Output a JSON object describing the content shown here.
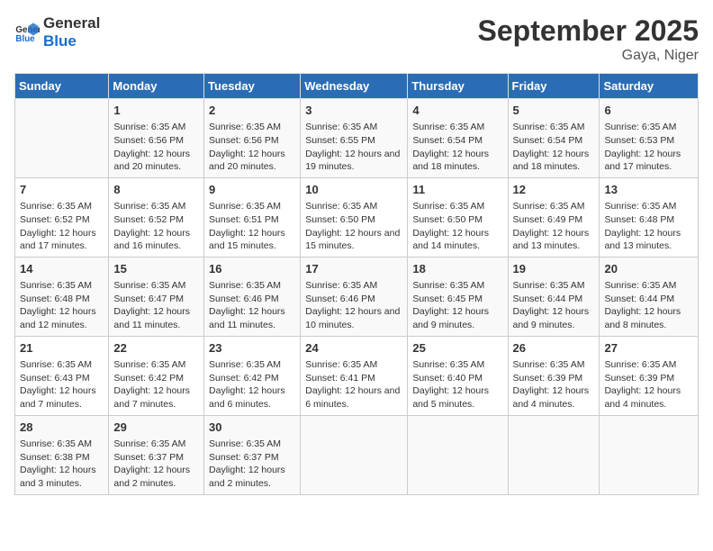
{
  "logo": {
    "line1": "General",
    "line2": "Blue"
  },
  "title": "September 2025",
  "location": "Gaya, Niger",
  "days_of_week": [
    "Sunday",
    "Monday",
    "Tuesday",
    "Wednesday",
    "Thursday",
    "Friday",
    "Saturday"
  ],
  "weeks": [
    [
      {
        "day": "",
        "info": ""
      },
      {
        "day": "1",
        "info": "Sunrise: 6:35 AM\nSunset: 6:56 PM\nDaylight: 12 hours and 20 minutes."
      },
      {
        "day": "2",
        "info": "Sunrise: 6:35 AM\nSunset: 6:56 PM\nDaylight: 12 hours and 20 minutes."
      },
      {
        "day": "3",
        "info": "Sunrise: 6:35 AM\nSunset: 6:55 PM\nDaylight: 12 hours and 19 minutes."
      },
      {
        "day": "4",
        "info": "Sunrise: 6:35 AM\nSunset: 6:54 PM\nDaylight: 12 hours and 18 minutes."
      },
      {
        "day": "5",
        "info": "Sunrise: 6:35 AM\nSunset: 6:54 PM\nDaylight: 12 hours and 18 minutes."
      },
      {
        "day": "6",
        "info": "Sunrise: 6:35 AM\nSunset: 6:53 PM\nDaylight: 12 hours and 17 minutes."
      }
    ],
    [
      {
        "day": "7",
        "info": "Sunrise: 6:35 AM\nSunset: 6:52 PM\nDaylight: 12 hours and 17 minutes."
      },
      {
        "day": "8",
        "info": "Sunrise: 6:35 AM\nSunset: 6:52 PM\nDaylight: 12 hours and 16 minutes."
      },
      {
        "day": "9",
        "info": "Sunrise: 6:35 AM\nSunset: 6:51 PM\nDaylight: 12 hours and 15 minutes."
      },
      {
        "day": "10",
        "info": "Sunrise: 6:35 AM\nSunset: 6:50 PM\nDaylight: 12 hours and 15 minutes."
      },
      {
        "day": "11",
        "info": "Sunrise: 6:35 AM\nSunset: 6:50 PM\nDaylight: 12 hours and 14 minutes."
      },
      {
        "day": "12",
        "info": "Sunrise: 6:35 AM\nSunset: 6:49 PM\nDaylight: 12 hours and 13 minutes."
      },
      {
        "day": "13",
        "info": "Sunrise: 6:35 AM\nSunset: 6:48 PM\nDaylight: 12 hours and 13 minutes."
      }
    ],
    [
      {
        "day": "14",
        "info": "Sunrise: 6:35 AM\nSunset: 6:48 PM\nDaylight: 12 hours and 12 minutes."
      },
      {
        "day": "15",
        "info": "Sunrise: 6:35 AM\nSunset: 6:47 PM\nDaylight: 12 hours and 11 minutes."
      },
      {
        "day": "16",
        "info": "Sunrise: 6:35 AM\nSunset: 6:46 PM\nDaylight: 12 hours and 11 minutes."
      },
      {
        "day": "17",
        "info": "Sunrise: 6:35 AM\nSunset: 6:46 PM\nDaylight: 12 hours and 10 minutes."
      },
      {
        "day": "18",
        "info": "Sunrise: 6:35 AM\nSunset: 6:45 PM\nDaylight: 12 hours and 9 minutes."
      },
      {
        "day": "19",
        "info": "Sunrise: 6:35 AM\nSunset: 6:44 PM\nDaylight: 12 hours and 9 minutes."
      },
      {
        "day": "20",
        "info": "Sunrise: 6:35 AM\nSunset: 6:44 PM\nDaylight: 12 hours and 8 minutes."
      }
    ],
    [
      {
        "day": "21",
        "info": "Sunrise: 6:35 AM\nSunset: 6:43 PM\nDaylight: 12 hours and 7 minutes."
      },
      {
        "day": "22",
        "info": "Sunrise: 6:35 AM\nSunset: 6:42 PM\nDaylight: 12 hours and 7 minutes."
      },
      {
        "day": "23",
        "info": "Sunrise: 6:35 AM\nSunset: 6:42 PM\nDaylight: 12 hours and 6 minutes."
      },
      {
        "day": "24",
        "info": "Sunrise: 6:35 AM\nSunset: 6:41 PM\nDaylight: 12 hours and 6 minutes."
      },
      {
        "day": "25",
        "info": "Sunrise: 6:35 AM\nSunset: 6:40 PM\nDaylight: 12 hours and 5 minutes."
      },
      {
        "day": "26",
        "info": "Sunrise: 6:35 AM\nSunset: 6:39 PM\nDaylight: 12 hours and 4 minutes."
      },
      {
        "day": "27",
        "info": "Sunrise: 6:35 AM\nSunset: 6:39 PM\nDaylight: 12 hours and 4 minutes."
      }
    ],
    [
      {
        "day": "28",
        "info": "Sunrise: 6:35 AM\nSunset: 6:38 PM\nDaylight: 12 hours and 3 minutes."
      },
      {
        "day": "29",
        "info": "Sunrise: 6:35 AM\nSunset: 6:37 PM\nDaylight: 12 hours and 2 minutes."
      },
      {
        "day": "30",
        "info": "Sunrise: 6:35 AM\nSunset: 6:37 PM\nDaylight: 12 hours and 2 minutes."
      },
      {
        "day": "",
        "info": ""
      },
      {
        "day": "",
        "info": ""
      },
      {
        "day": "",
        "info": ""
      },
      {
        "day": "",
        "info": ""
      }
    ]
  ]
}
